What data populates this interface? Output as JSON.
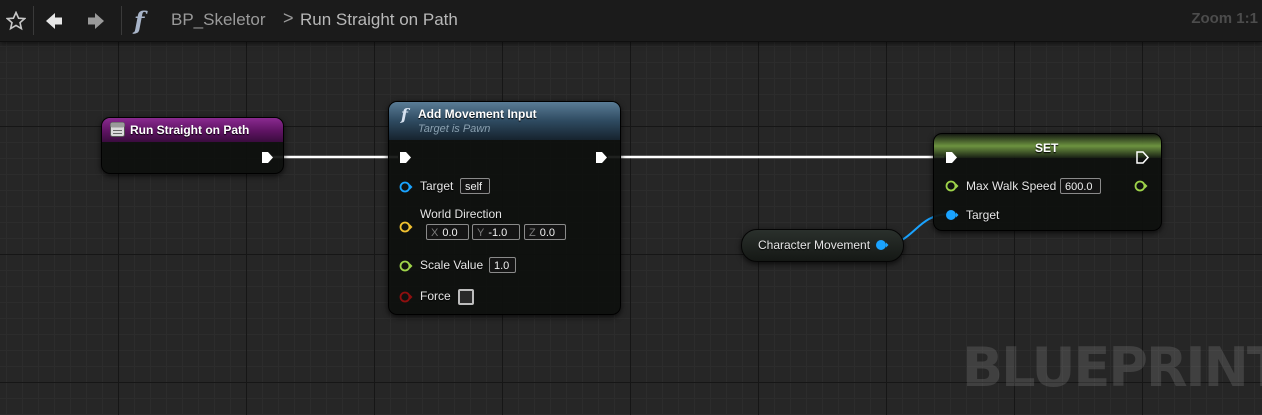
{
  "toolbar": {
    "favorite_icon": "star-outline-icon",
    "back_icon": "back-arrow-icon",
    "forward_icon": "forward-arrow-icon",
    "function_icon": "f"
  },
  "breadcrumb": {
    "blueprint": "BP_Skeletor",
    "separator": ">",
    "graph": "Run Straight on Path"
  },
  "zoom_label": "Zoom 1:1",
  "watermark": "BLUEPRINT",
  "nodes": {
    "event": {
      "title": "Run Straight on Path",
      "icon": "custom-event-icon",
      "color": "#6a1a6e"
    },
    "add_movement": {
      "title": "Add Movement Input",
      "subtitle": "Target is Pawn",
      "icon": "f",
      "color": "#3a5266",
      "pins": {
        "target_label": "Target",
        "target_value": "self",
        "world_direction_label": "World Direction",
        "x_label": "X",
        "x_value": "0.0",
        "y_label": "Y",
        "y_value": "-1.0",
        "z_label": "Z",
        "z_value": "0.0",
        "scale_label": "Scale Value",
        "scale_value": "1.0",
        "force_label": "Force",
        "force_checked": false
      }
    },
    "set": {
      "title": "SET",
      "color": "#6a8a40",
      "pins": {
        "max_walk_speed_label": "Max Walk Speed",
        "max_walk_speed_value": "600.0",
        "target_label": "Target"
      }
    },
    "character_movement": {
      "label": "Character Movement"
    }
  },
  "pin_colors": {
    "exec": "#ffffff",
    "object": "#1aa3ff",
    "vector": "#f0c030",
    "float": "#9ed34a",
    "bool": "#8e0f0f"
  }
}
